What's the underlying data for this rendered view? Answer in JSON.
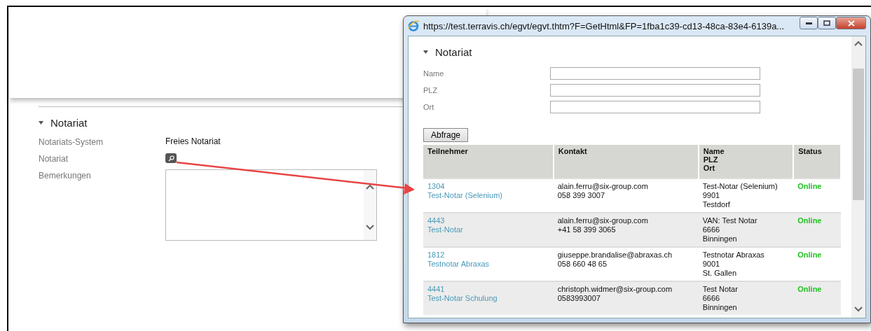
{
  "page": {
    "section": {
      "title": "Notariat",
      "expanded": true
    },
    "fields": [
      {
        "label": "Notariats-System",
        "kind": "text",
        "value": "Freies Notariat"
      },
      {
        "label": "Notariat",
        "kind": "lookup"
      },
      {
        "label": "Bemerkungen",
        "kind": "textarea"
      }
    ]
  },
  "popup": {
    "title": "https://test.terravis.ch/egvt/egvt.thtm?F=GetHtml&FP=1fba1c39-cd13-48ca-83e4-6139a...",
    "section": {
      "title": "Notariat",
      "expanded": true
    },
    "filters": [
      {
        "label": "Name"
      },
      {
        "label": "PLZ"
      },
      {
        "label": "Ort"
      }
    ],
    "search_button": "Abfrage",
    "table": {
      "columns": [
        [
          "Teilnehmer"
        ],
        [
          "Kontakt"
        ],
        [
          "Name",
          "PLZ",
          "Ort"
        ],
        [
          "Status"
        ]
      ],
      "rows": [
        {
          "id": "1304",
          "name": "Test-Notar (Selenium)",
          "email": "alain.ferru@six-group.com",
          "phone": "058 399 3007",
          "address": [
            "Test-Notar (Selenium)",
            "9901",
            "Testdorf"
          ],
          "status": "Online",
          "online": true
        },
        {
          "id": "4443",
          "name": "Test-Notar",
          "email": "alain.ferru@six-group.com",
          "phone": "+41 58 399 3065",
          "address": [
            "VAN: Test Notar",
            "6666",
            "Binningen"
          ],
          "status": "Online",
          "online": true
        },
        {
          "id": "1812",
          "name": "Testnotar Abraxas",
          "email": "giuseppe.brandalise@abraxas.ch",
          "phone": "058 660 48 65",
          "address": [
            "Testnotar Abraxas",
            "9001",
            "St. Gallen"
          ],
          "status": "Online",
          "online": true
        },
        {
          "id": "4441",
          "name": "Test-Notar Schulung",
          "email": "christoph.widmer@six-group.com",
          "phone": "0583993007",
          "address": [
            "Test Notar",
            "6666",
            "Binningen"
          ],
          "status": "Online",
          "online": true
        }
      ]
    }
  }
}
